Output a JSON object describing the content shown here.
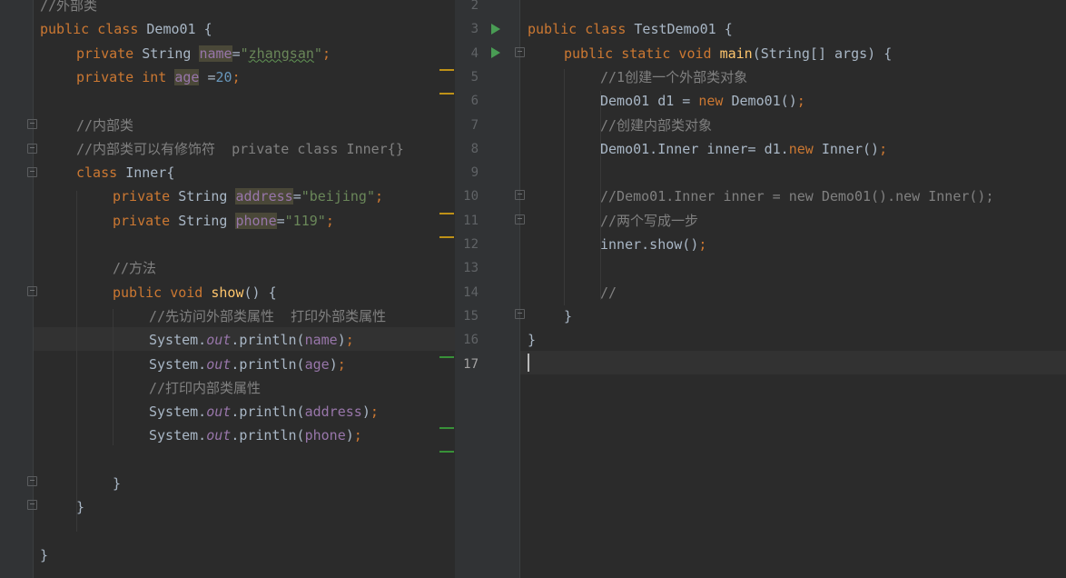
{
  "left_editor": {
    "lines": [
      {
        "indent": 0,
        "tokens": [
          {
            "t": "//外部类",
            "c": "cm"
          }
        ]
      },
      {
        "indent": 0,
        "tokens": [
          {
            "t": "public class ",
            "c": "kw"
          },
          {
            "t": "Demo01 {",
            "c": ""
          }
        ]
      },
      {
        "indent": 1,
        "tokens": [
          {
            "t": "private ",
            "c": "kw"
          },
          {
            "t": "String ",
            "c": ""
          },
          {
            "t": "name",
            "c": "fld hl"
          },
          {
            "t": "=",
            "c": ""
          },
          {
            "t": "\"",
            "c": "str"
          },
          {
            "t": "zhangsan",
            "c": "str typo"
          },
          {
            "t": "\"",
            "c": "str"
          },
          {
            "t": ";",
            "c": "kw"
          }
        ]
      },
      {
        "indent": 1,
        "tokens": [
          {
            "t": "private ",
            "c": "kw"
          },
          {
            "t": "int ",
            "c": "kw"
          },
          {
            "t": "age",
            "c": "fld hl"
          },
          {
            "t": " =",
            "c": ""
          },
          {
            "t": "20",
            "c": "num"
          },
          {
            "t": ";",
            "c": "kw"
          }
        ]
      },
      {
        "indent": 0,
        "tokens": []
      },
      {
        "indent": 1,
        "tokens": [
          {
            "t": "//内部类",
            "c": "cm"
          }
        ]
      },
      {
        "indent": 1,
        "tokens": [
          {
            "t": "//内部类可以有修饰符  private class Inner{}",
            "c": "cm"
          }
        ]
      },
      {
        "indent": 1,
        "tokens": [
          {
            "t": "class ",
            "c": "kw"
          },
          {
            "t": "Inner{",
            "c": ""
          }
        ]
      },
      {
        "indent": 2,
        "tokens": [
          {
            "t": "private ",
            "c": "kw"
          },
          {
            "t": "String ",
            "c": ""
          },
          {
            "t": "address",
            "c": "fld hl"
          },
          {
            "t": "=",
            "c": ""
          },
          {
            "t": "\"beijing\"",
            "c": "str"
          },
          {
            "t": ";",
            "c": "kw"
          }
        ]
      },
      {
        "indent": 2,
        "tokens": [
          {
            "t": "private ",
            "c": "kw"
          },
          {
            "t": "String ",
            "c": ""
          },
          {
            "t": "phone",
            "c": "fld hl"
          },
          {
            "t": "=",
            "c": ""
          },
          {
            "t": "\"119\"",
            "c": "str"
          },
          {
            "t": ";",
            "c": "kw"
          }
        ]
      },
      {
        "indent": 0,
        "tokens": []
      },
      {
        "indent": 2,
        "tokens": [
          {
            "t": "//方法",
            "c": "cm"
          }
        ]
      },
      {
        "indent": 2,
        "tokens": [
          {
            "t": "public ",
            "c": "kw"
          },
          {
            "t": "void ",
            "c": "kw"
          },
          {
            "t": "show",
            "c": "fn"
          },
          {
            "t": "() {",
            "c": ""
          }
        ]
      },
      {
        "indent": 3,
        "tokens": [
          {
            "t": "//先访问外部类属性  打印外部类属性",
            "c": "cm"
          }
        ]
      },
      {
        "indent": 3,
        "tokens": [
          {
            "t": "System.",
            "c": ""
          },
          {
            "t": "out",
            "c": "sfld"
          },
          {
            "t": ".println(",
            "c": ""
          },
          {
            "t": "name",
            "c": "fld"
          },
          {
            "t": ")",
            "c": ""
          },
          {
            "t": ";",
            "c": "kw"
          }
        ]
      },
      {
        "indent": 3,
        "tokens": [
          {
            "t": "System.",
            "c": ""
          },
          {
            "t": "out",
            "c": "sfld"
          },
          {
            "t": ".println(",
            "c": ""
          },
          {
            "t": "age",
            "c": "fld"
          },
          {
            "t": ")",
            "c": ""
          },
          {
            "t": ";",
            "c": "kw"
          }
        ]
      },
      {
        "indent": 3,
        "tokens": [
          {
            "t": "//打印内部类属性",
            "c": "cm"
          }
        ]
      },
      {
        "indent": 3,
        "tokens": [
          {
            "t": "System.",
            "c": ""
          },
          {
            "t": "out",
            "c": "sfld"
          },
          {
            "t": ".println(",
            "c": ""
          },
          {
            "t": "address",
            "c": "fld"
          },
          {
            "t": ")",
            "c": ""
          },
          {
            "t": ";",
            "c": "kw"
          }
        ]
      },
      {
        "indent": 3,
        "tokens": [
          {
            "t": "System.",
            "c": ""
          },
          {
            "t": "out",
            "c": "sfld"
          },
          {
            "t": ".println(",
            "c": ""
          },
          {
            "t": "phone",
            "c": "fld"
          },
          {
            "t": ")",
            "c": ""
          },
          {
            "t": ";",
            "c": "kw"
          }
        ]
      },
      {
        "indent": 0,
        "tokens": []
      },
      {
        "indent": 2,
        "tokens": [
          {
            "t": "}",
            "c": ""
          }
        ]
      },
      {
        "indent": 1,
        "tokens": [
          {
            "t": "}",
            "c": ""
          }
        ]
      },
      {
        "indent": 0,
        "tokens": []
      },
      {
        "indent": 0,
        "tokens": [
          {
            "t": "}",
            "c": ""
          }
        ]
      }
    ]
  },
  "right_editor": {
    "line_numbers": [
      "2",
      "3",
      "4",
      "5",
      "6",
      "7",
      "8",
      "9",
      "10",
      "11",
      "12",
      "13",
      "14",
      "15",
      "16",
      "17"
    ],
    "current_line": "17",
    "lines": [
      {
        "indent": 0,
        "tokens": []
      },
      {
        "indent": 0,
        "tokens": [
          {
            "t": "public class ",
            "c": "kw"
          },
          {
            "t": "TestDemo01 {",
            "c": ""
          }
        ]
      },
      {
        "indent": 1,
        "tokens": [
          {
            "t": "public static void ",
            "c": "kw"
          },
          {
            "t": "main",
            "c": "fn"
          },
          {
            "t": "(String[] args) {",
            "c": ""
          }
        ]
      },
      {
        "indent": 2,
        "tokens": [
          {
            "t": "//1创建一个外部类对象",
            "c": "cm"
          }
        ]
      },
      {
        "indent": 2,
        "tokens": [
          {
            "t": "Demo01 d1 = ",
            "c": ""
          },
          {
            "t": "new ",
            "c": "kw"
          },
          {
            "t": "Demo01()",
            "c": ""
          },
          {
            "t": ";",
            "c": "kw"
          }
        ]
      },
      {
        "indent": 2,
        "tokens": [
          {
            "t": "//创建内部类对象",
            "c": "cm"
          }
        ]
      },
      {
        "indent": 2,
        "tokens": [
          {
            "t": "Demo01.Inner inner= d1.",
            "c": ""
          },
          {
            "t": "new ",
            "c": "kw"
          },
          {
            "t": "Inner()",
            "c": ""
          },
          {
            "t": ";",
            "c": "kw"
          }
        ]
      },
      {
        "indent": 0,
        "tokens": []
      },
      {
        "indent": 2,
        "tokens": [
          {
            "t": "//Demo01.Inner inner = new Demo01().new Inner();",
            "c": "cm"
          }
        ]
      },
      {
        "indent": 2,
        "tokens": [
          {
            "t": "//两个写成一步",
            "c": "cm"
          }
        ]
      },
      {
        "indent": 2,
        "tokens": [
          {
            "t": "inner.show()",
            "c": ""
          },
          {
            "t": ";",
            "c": "kw"
          }
        ]
      },
      {
        "indent": 0,
        "tokens": []
      },
      {
        "indent": 2,
        "tokens": [
          {
            "t": "//",
            "c": "cm"
          }
        ]
      },
      {
        "indent": 1,
        "tokens": [
          {
            "t": "}",
            "c": ""
          }
        ]
      },
      {
        "indent": 0,
        "tokens": [
          {
            "t": "}",
            "c": ""
          }
        ]
      },
      {
        "indent": 0,
        "tokens": []
      }
    ]
  },
  "icons": {
    "run": "run-gutter-icon",
    "fold": "fold-marker-icon",
    "marker_warning": "warning-stripe",
    "marker_ok": "changed-stripe"
  },
  "colors": {
    "background": "#2b2b2b",
    "keyword": "#cc7832",
    "string": "#6a8759",
    "number": "#6897bb",
    "comment": "#808080",
    "field": "#9876aa",
    "method": "#ffc66d",
    "run": "#499c54"
  }
}
